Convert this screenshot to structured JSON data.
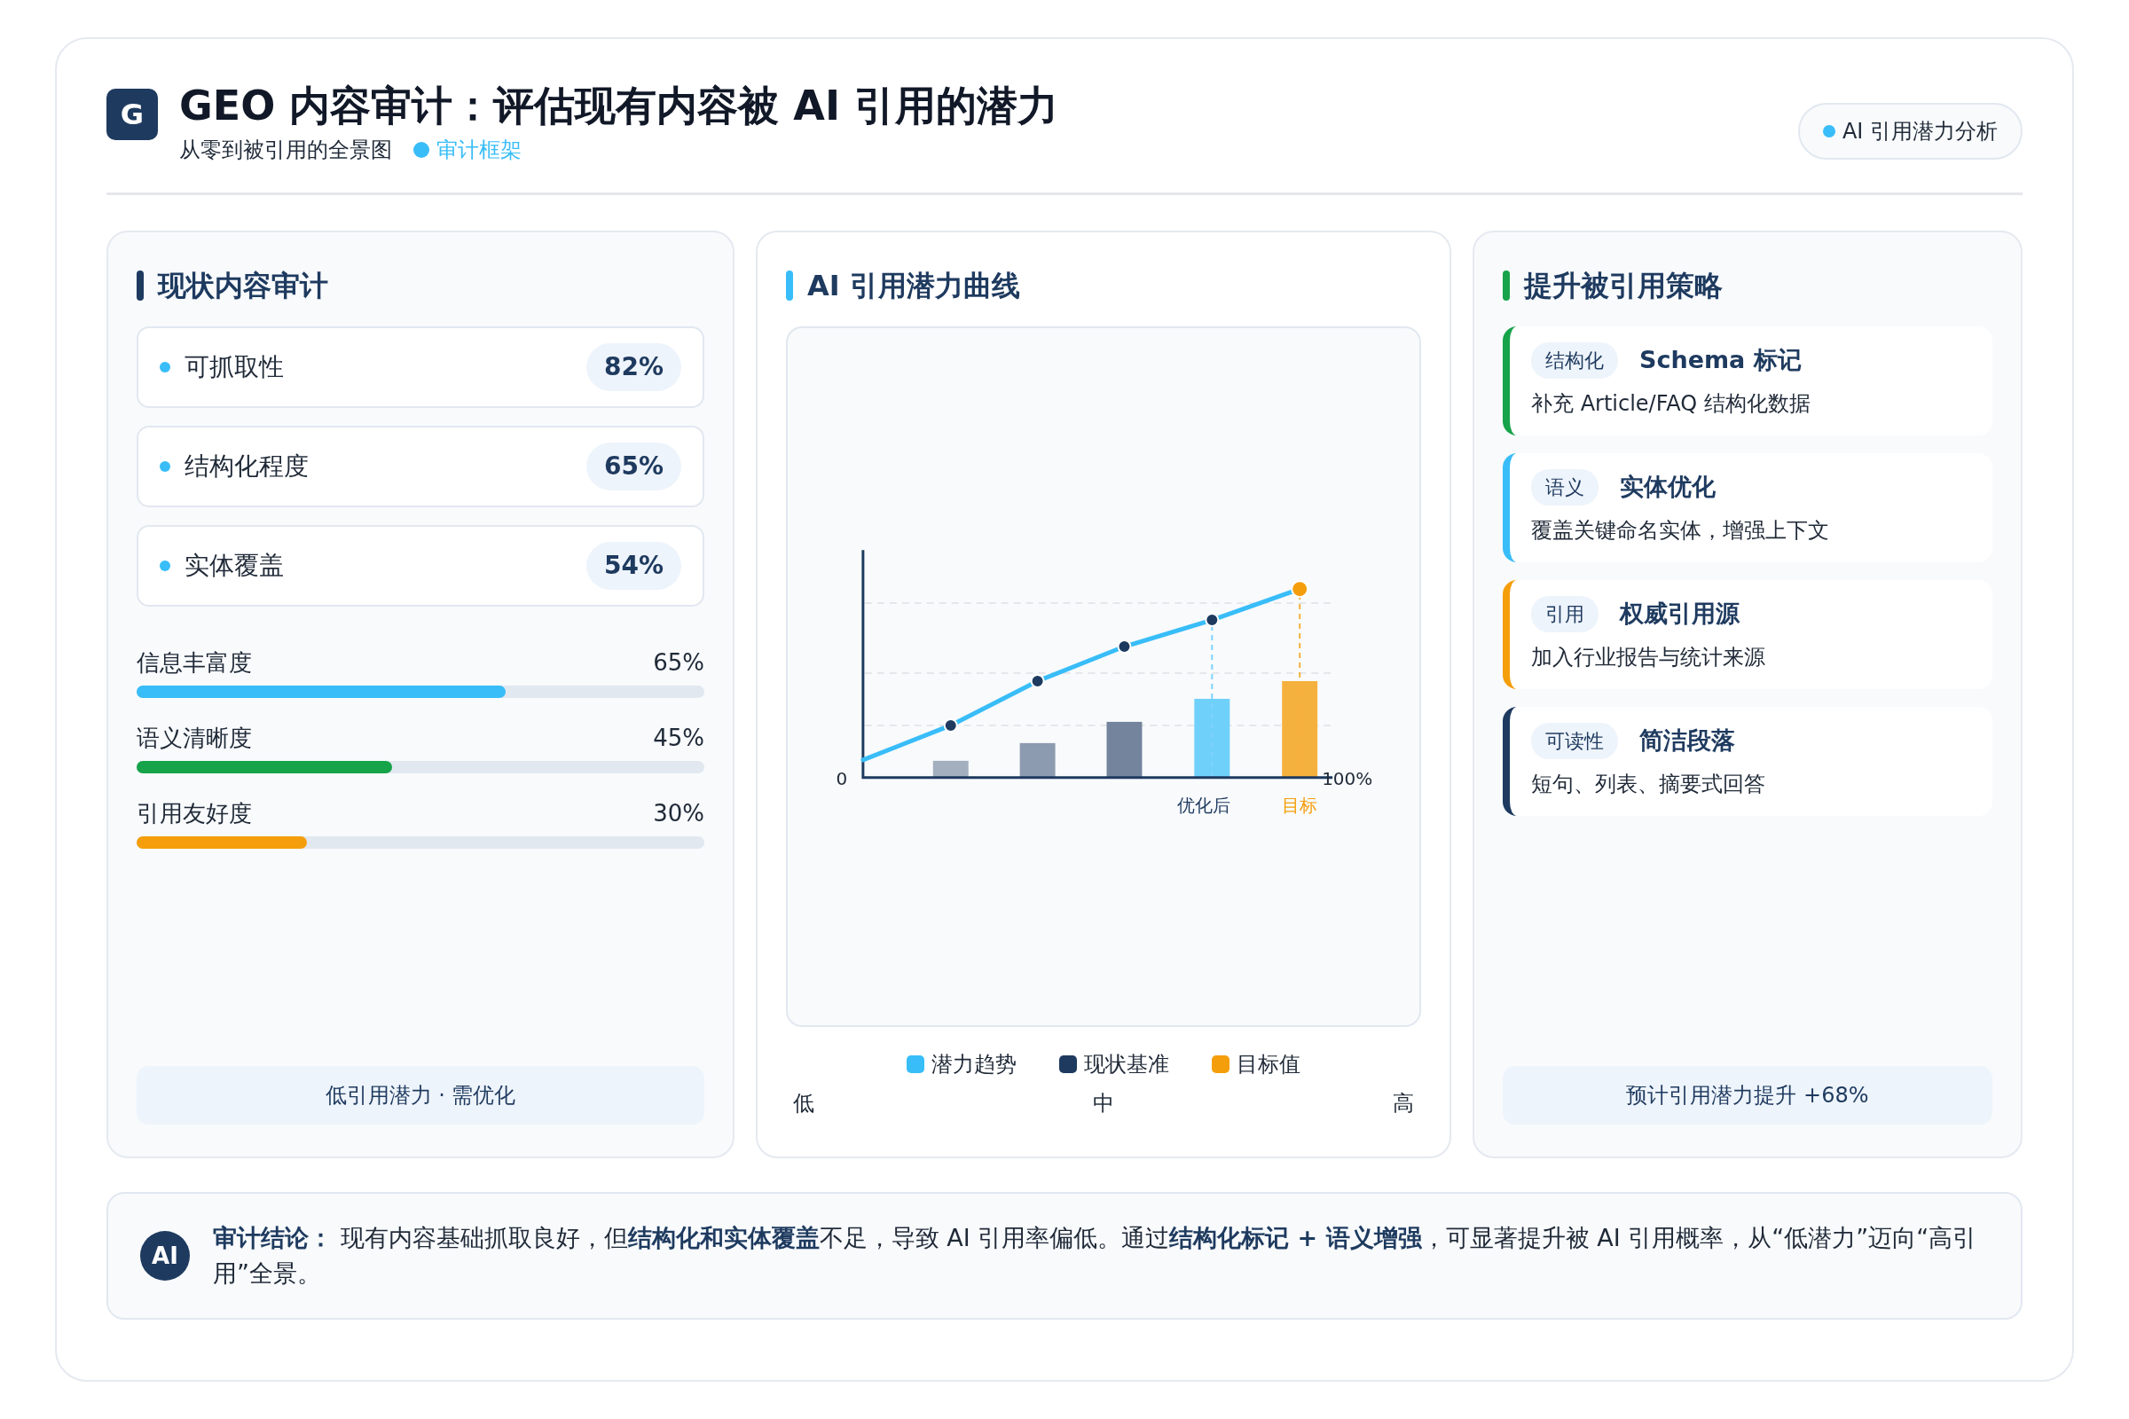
{
  "header": {
    "logo": "G",
    "title": "GEO 内容审计：评估现有内容被 AI 引用的潜力",
    "subtitle": "从零到被引用的全景图",
    "tag": {
      "label": "审计框架",
      "color": "#38bdf8"
    },
    "badge": {
      "label": "AI 引用潜力分析",
      "color": "#38bdf8"
    }
  },
  "audit_panel": {
    "title": "现状内容审计",
    "color": "#1e3a5f",
    "metrics": [
      {
        "label": "可抓取性",
        "value": "82%"
      },
      {
        "label": "结构化程度",
        "value": "65%"
      },
      {
        "label": "实体覆盖",
        "value": "54%"
      }
    ],
    "bars": [
      {
        "label": "信息丰富度",
        "reading": "65%",
        "level": 0.65,
        "color": "#38bdf8"
      },
      {
        "label": "语义清晰度",
        "reading": "45%",
        "level": 0.45,
        "color": "#16a34a"
      },
      {
        "label": "引用友好度",
        "reading": "30%",
        "level": 0.3,
        "color": "#f59e0b"
      }
    ],
    "footer": "低引用潜力 · 需优化"
  },
  "chart_panel": {
    "title": "AI 引用潜力曲线",
    "color": "#38bdf8",
    "axis_labels": [
      "0",
      "100%"
    ],
    "bar_labels": [
      {
        "text": "优化后",
        "kind": "current"
      },
      {
        "text": "目标",
        "kind": "target"
      }
    ],
    "legend": [
      {
        "label": "潜力趋势",
        "color": "#38bdf8"
      },
      {
        "label": "现状基准",
        "color": "#1e3a5f"
      },
      {
        "label": "目标值",
        "color": "#f59e0b"
      }
    ],
    "scale": [
      "低",
      "中",
      "高"
    ]
  },
  "strategy_panel": {
    "title": "提升被引用策略",
    "color": "#16a34a",
    "items": [
      {
        "tag": "结构化",
        "title": "Schema 标记",
        "description": "补充 Article/FAQ 结构化数据",
        "color": "#16a34a"
      },
      {
        "tag": "语义",
        "title": "实体优化",
        "description": "覆盖关键命名实体，增强上下文",
        "color": "#38bdf8"
      },
      {
        "tag": "引用",
        "title": "权威引用源",
        "description": "加入行业报告与统计来源",
        "color": "#f59e0b"
      },
      {
        "tag": "可读性",
        "title": "简洁段落",
        "description": "短句、列表、摘要式回答",
        "color": "#1e3a5f"
      }
    ],
    "footer": "预计引用潜力提升 +68%"
  },
  "conclusion": {
    "icon": "AI",
    "text": "**审计结论：** 现有内容基础抓取良好，但**结构化和实体覆盖**不足，导致 AI 引用率偏低。通过**结构化标记 + 语义增强**，可显著提升被 AI 引用概率，从“低潜力”迈向“高引用”全景。"
  }
}
